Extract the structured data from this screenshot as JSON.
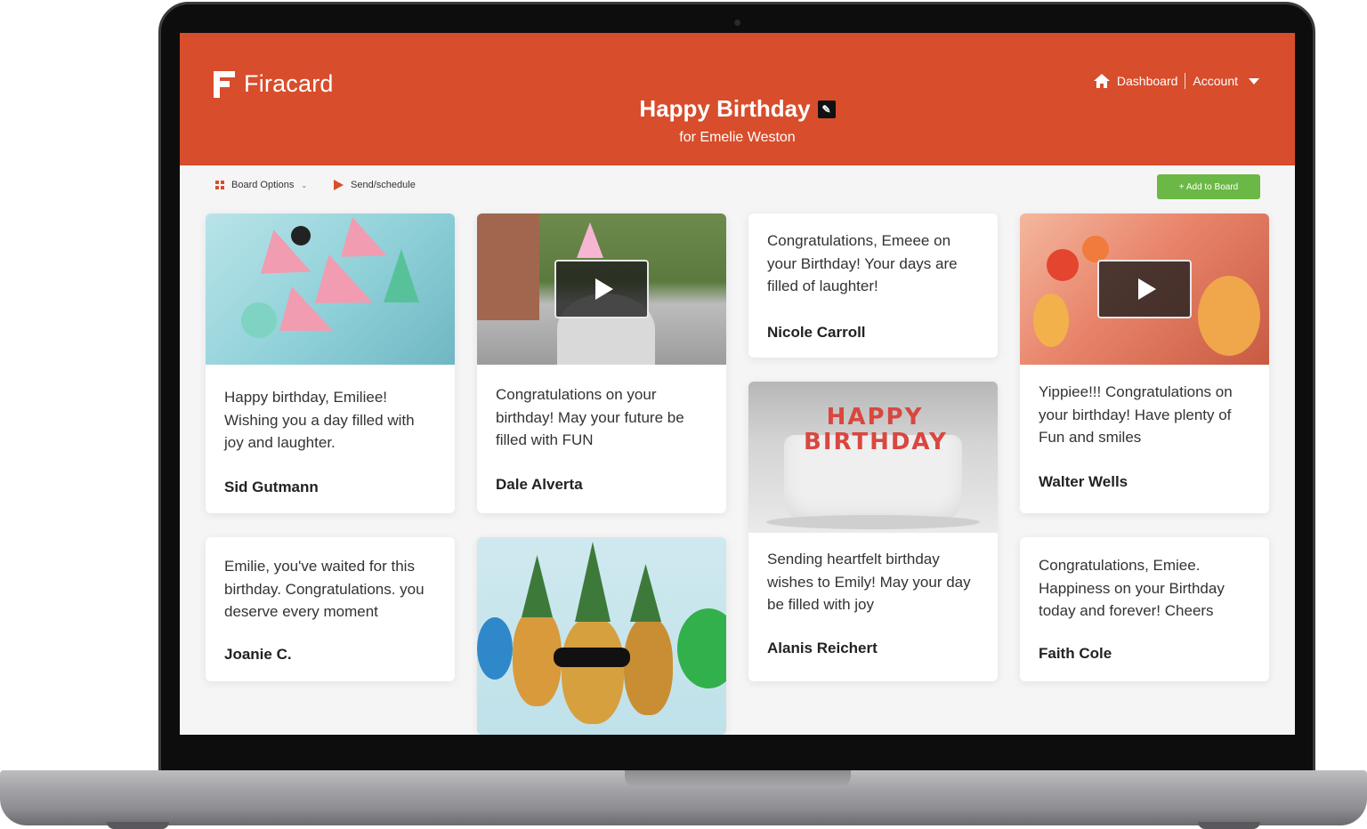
{
  "brand": {
    "name": "Firacard",
    "accent": "#d84d2b",
    "button_green": "#6bb846"
  },
  "header": {
    "title": "Happy Birthday",
    "subtitle": "for Emelie Weston",
    "nav": {
      "dashboard": "Dashboard",
      "account": "Account"
    }
  },
  "toolbar": {
    "board_options": "Board Options",
    "send_schedule": "Send/schedule",
    "add_to_board": "+ Add to Board"
  },
  "cards": {
    "c1": {
      "message": "Happy birthday, Emiliee! Wishing you a day filled with joy and laughter.",
      "author": "Sid Gutmann"
    },
    "c2": {
      "message": "Congratulations on your birthday! May your future be filled with FUN",
      "author": "Dale Alverta"
    },
    "c3": {
      "message": "Congratulations, Emeee on your Birthday!  Your days are filled of laughter!",
      "author": "Nicole Carroll"
    },
    "c4": {
      "message": "Yippiee!!! Congratulations on your  birthday! Have plenty of Fun and smiles",
      "author": "Walter Wells"
    },
    "c5": {
      "message": "Emilie, you've waited for this birthday. Congratulations. you deserve every moment",
      "author": "Joanie C."
    },
    "c6": {
      "message": "Sending heartfelt birthday wishes to Emily! May your day be filled with joy",
      "author": "Alanis Reichert"
    },
    "c7": {
      "message": "Congratulations, Emiee. Happiness on your Birthday today and forever! Cheers",
      "author": "Faith Cole"
    },
    "cake_topper": "HAPPY BIRTHDAY"
  }
}
